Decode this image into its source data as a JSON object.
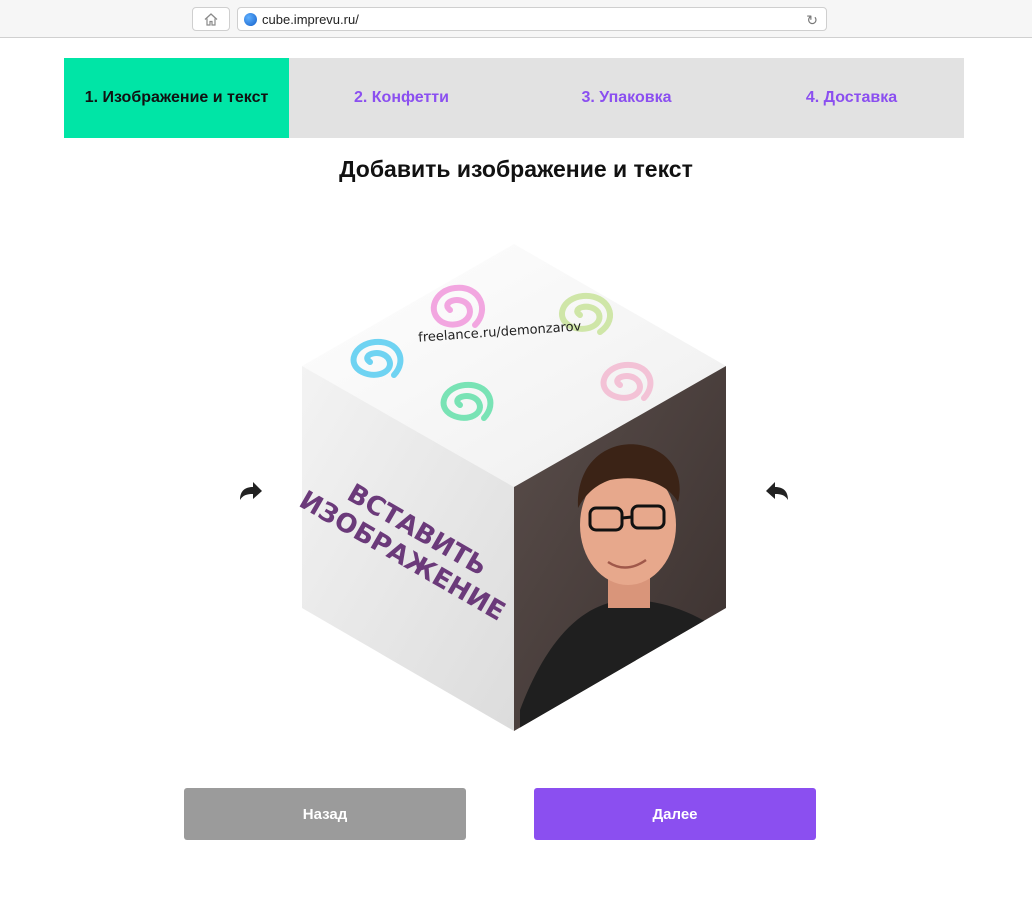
{
  "browser": {
    "url": "cube.imprevu.ru/"
  },
  "steps": [
    {
      "label": "1. Изображение и текст"
    },
    {
      "label": "2. Конфетти"
    },
    {
      "label": "3. Упаковка"
    },
    {
      "label": "4. Доставка"
    }
  ],
  "page_title": "Добавить изображение и текст",
  "cube": {
    "top_text": "freelance.ru/demonzarov",
    "left_text_line1": "ВСТАВИТЬ",
    "left_text_line2": "ИЗОБРАЖЕНИЕ"
  },
  "buttons": {
    "back": "Назад",
    "next": "Далее"
  },
  "colors": {
    "accent_active": "#00e5a6",
    "accent_purple": "#8b4ff0",
    "tab_bg": "#e2e2e2",
    "back_btn": "#9b9b9b",
    "cube_text": "#6b3a7a"
  },
  "icons": [
    "home-icon",
    "globe-icon",
    "reload-icon",
    "rotate-left-icon",
    "rotate-right-icon"
  ]
}
